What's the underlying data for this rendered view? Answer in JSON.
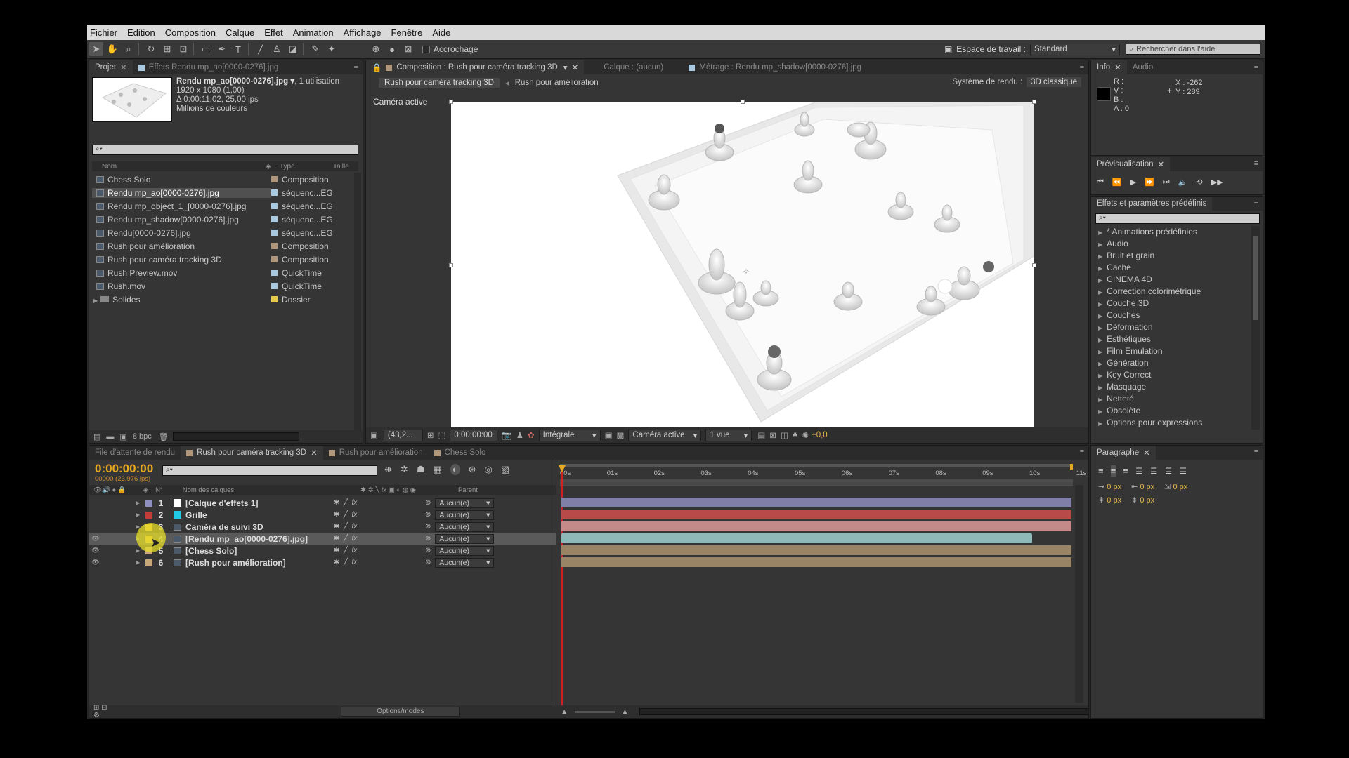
{
  "menu": [
    "Fichier",
    "Edition",
    "Composition",
    "Calque",
    "Effet",
    "Animation",
    "Affichage",
    "Fenêtre",
    "Aide"
  ],
  "toolbar": {
    "snap_label": "Accrochage",
    "workspace_label": "Espace de travail :",
    "workspace_value": "Standard",
    "help_placeholder": "Rechercher dans l'aide"
  },
  "project": {
    "tabs": [
      "Projet",
      "Effets Rendu mp_ao[0000-0276].jpg"
    ],
    "thumb_name": "Rendu mp_ao[0000-0276].jpg ▾",
    "thumb_usage": ", 1 utilisation",
    "thumb_line2": "1920 x 1080 (1,00)",
    "thumb_line3": "Δ 0:00:11:02, 25,00 ips",
    "thumb_line4": "Millions de couleurs",
    "search_icon": "⌕▾",
    "col_name": "Nom",
    "col_type": "Type",
    "col_size": "Taille",
    "items": [
      {
        "name": "Chess Solo",
        "type": "Composition",
        "color": "#b0967a",
        "icon": "comp-icon"
      },
      {
        "name": "Rendu mp_ao[0000-0276].jpg",
        "type": "séquenc...EG",
        "color": "#a9c9e0",
        "icon": "sequence-icon"
      },
      {
        "name": "Rendu mp_object_1_[0000-0276].jpg",
        "type": "séquenc...EG",
        "color": "#a9c9e0",
        "icon": "sequence-icon"
      },
      {
        "name": "Rendu mp_shadow[0000-0276].jpg",
        "type": "séquenc...EG",
        "color": "#a9c9e0",
        "icon": "sequence-icon"
      },
      {
        "name": "Rendu[0000-0276].jpg",
        "type": "séquenc...EG",
        "color": "#a9c9e0",
        "icon": "sequence-icon"
      },
      {
        "name": "Rush pour amélioration",
        "type": "Composition",
        "color": "#b0967a",
        "icon": "comp-icon"
      },
      {
        "name": "Rush pour caméra tracking 3D",
        "type": "Composition",
        "color": "#b0967a",
        "icon": "comp-icon"
      },
      {
        "name": "Rush Preview.mov",
        "type": "QuickTime",
        "color": "#a9c9e0",
        "icon": "file-icon"
      },
      {
        "name": "Rush.mov",
        "type": "QuickTime",
        "color": "#a9c9e0",
        "icon": "file-icon"
      },
      {
        "name": "Solides",
        "type": "Dossier",
        "color": "#e6c84a",
        "icon": "folder-icon"
      }
    ],
    "bpc": "8 bpc"
  },
  "viewer": {
    "tabs": [
      "Composition : Rush pour caméra tracking 3D",
      "Calque : (aucun)",
      "Métrage : Rendu mp_shadow[0000-0276].jpg"
    ],
    "crumb1": "Rush pour caméra tracking 3D",
    "crumb2": "Rush pour amélioration",
    "renderer_label": "Système de rendu :",
    "renderer_value": "3D classique",
    "camera_label": "Caméra active",
    "zoom": "(43,2...",
    "time": "0:00:00:00",
    "resolution": "Intégrale",
    "camera_select": "Caméra active",
    "views": "1 vue",
    "exposure": "+0,0"
  },
  "info": {
    "tabs": [
      "Info",
      "Audio"
    ],
    "r": "R :",
    "v": "V :",
    "b": "B :",
    "a": "A : 0",
    "x": "X : -262",
    "y": "Y : 289"
  },
  "preview": {
    "tab": "Prévisualisation"
  },
  "effects": {
    "tab": "Effets et paramètres prédéfinis",
    "items": [
      "* Animations prédéfinies",
      "Audio",
      "Bruit et grain",
      "Cache",
      "CINEMA 4D",
      "Correction colorimétrique",
      "Couche 3D",
      "Couches",
      "Déformation",
      "Esthétiques",
      "Film Emulation",
      "Génération",
      "Key Correct",
      "Masquage",
      "Netteté",
      "Obsolète",
      "Options pour expressions"
    ]
  },
  "timeline": {
    "tabs": [
      "File d'attente de rendu",
      "Rush pour caméra tracking 3D",
      "Rush pour amélioration",
      "Chess Solo"
    ],
    "timecode": "0:00:00:00",
    "frames": "00000 (23.976 ips)",
    "col_num": "N°",
    "col_name": "Nom des calques",
    "col_parent": "Parent",
    "ruler": [
      "00s",
      "01s",
      "02s",
      "03s",
      "04s",
      "05s",
      "06s",
      "07s",
      "08s",
      "09s",
      "10s",
      "11s"
    ],
    "layers": [
      {
        "num": "1",
        "name": "[Calque d'effets 1]",
        "label": "#9090c0",
        "swatch": "#ffffff",
        "parent": "Aucun(e)",
        "bar": "#7f7fa8"
      },
      {
        "num": "2",
        "name": "Grille",
        "label": "#c43c3c",
        "swatch": "#22c8e8",
        "parent": "Aucun(e)",
        "bar": "#b84a4a"
      },
      {
        "num": "3",
        "name": "Caméra de suivi 3D",
        "label": "#e8c040",
        "swatch": "",
        "parent": "Aucun(e)",
        "bar": "#c48a8a"
      },
      {
        "num": "4",
        "name": "[Rendu mp_ao[0000-0276].jpg]",
        "label": "#e8c040",
        "swatch": "",
        "parent": "Aucun(e)",
        "bar": "#8fb8b8"
      },
      {
        "num": "5",
        "name": "[Chess Solo]",
        "label": "#c8a878",
        "swatch": "",
        "parent": "Aucun(e)",
        "bar": "#9a8466"
      },
      {
        "num": "6",
        "name": "[Rush pour amélioration]",
        "label": "#c8a878",
        "swatch": "",
        "parent": "Aucun(e)",
        "bar": "#9a8466"
      }
    ],
    "options_label": "Options/modes"
  },
  "paragraph": {
    "tab": "Paragraphe",
    "px": "0 px"
  }
}
